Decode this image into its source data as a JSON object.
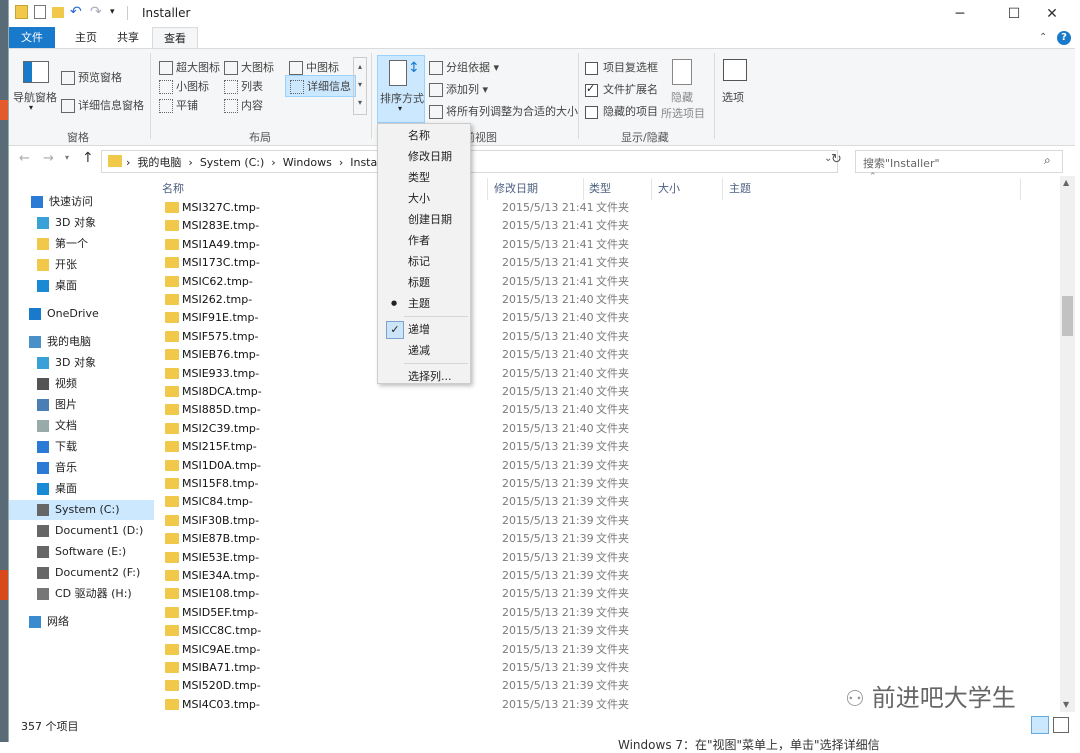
{
  "window": {
    "title": "Installer",
    "controls": {
      "minimize": "─",
      "maximize": "☐",
      "close": "✕"
    }
  },
  "tabs": [
    "文件",
    "主页",
    "共享",
    "查看"
  ],
  "ribbon": {
    "panes": {
      "nav_pane": "导航窗格",
      "preview_pane": "预览窗格",
      "details_pane": "详细信息窗格",
      "group": "窗格"
    },
    "layout": {
      "items": [
        "超大图标",
        "大图标",
        "中图标",
        "小图标",
        "列表",
        "详细信息",
        "平铺",
        "内容"
      ],
      "group": "布局"
    },
    "current_view": {
      "sort_by": "排序方式",
      "group_by": "分组依据",
      "add_columns": "添加列",
      "size_all_columns": "将所有列调整为合适的大小",
      "group": "当前视图",
      "group_visible": "前视图"
    },
    "show_hide": {
      "item_checkboxes": "项目复选框",
      "file_extensions": "文件扩展名",
      "hidden_items": "隐藏的项目",
      "hide_selected_1": "隐藏",
      "hide_selected_2": "所选项目",
      "group": "显示/隐藏",
      "item_checkboxes_checked": false,
      "file_extensions_checked": true,
      "hidden_items_checked": false
    },
    "options": "选项",
    "help": "?"
  },
  "address": {
    "crumbs": [
      "我的电脑",
      "System (C:)",
      "Windows",
      "Install"
    ],
    "search_placeholder": "搜索\"Installer\""
  },
  "nav": [
    {
      "label": "快速访问",
      "icon": "star-icon"
    },
    {
      "label": "3D 对象",
      "icon": "cube-icon"
    },
    {
      "label": "第一个",
      "icon": "folder-icon"
    },
    {
      "label": "开张",
      "icon": "folder-icon"
    },
    {
      "label": "桌面",
      "icon": "desktop-icon"
    },
    {
      "label": "OneDrive",
      "icon": "cloud-icon"
    },
    {
      "label": "我的电脑",
      "icon": "computer-icon"
    },
    {
      "label": "3D 对象",
      "icon": "cube-icon"
    },
    {
      "label": "视频",
      "icon": "video-icon"
    },
    {
      "label": "图片",
      "icon": "picture-icon"
    },
    {
      "label": "文档",
      "icon": "document-icon"
    },
    {
      "label": "下载",
      "icon": "download-icon"
    },
    {
      "label": "音乐",
      "icon": "music-icon"
    },
    {
      "label": "桌面",
      "icon": "desktop-icon"
    },
    {
      "label": "System (C:)",
      "icon": "drive-icon"
    },
    {
      "label": "Document1 (D:)",
      "icon": "drive-icon"
    },
    {
      "label": "Software (E:)",
      "icon": "drive-icon"
    },
    {
      "label": "Document2 (F:)",
      "icon": "drive-icon"
    },
    {
      "label": "CD 驱动器 (H:)",
      "icon": "cd-icon"
    },
    {
      "label": "网络",
      "icon": "network-icon"
    }
  ],
  "columns": [
    "名称",
    "修改日期",
    "类型",
    "大小",
    "主题"
  ],
  "files": [
    {
      "name": "MSI327C.tmp-",
      "date": "2015/5/13 21:41",
      "type": "文件夹"
    },
    {
      "name": "MSI283E.tmp-",
      "date": "2015/5/13 21:41",
      "type": "文件夹"
    },
    {
      "name": "MSI1A49.tmp-",
      "date": "2015/5/13 21:41",
      "type": "文件夹"
    },
    {
      "name": "MSI173C.tmp-",
      "date": "2015/5/13 21:41",
      "type": "文件夹"
    },
    {
      "name": "MSIC62.tmp-",
      "date": "2015/5/13 21:41",
      "type": "文件夹"
    },
    {
      "name": "MSI262.tmp-",
      "date": "2015/5/13 21:40",
      "type": "文件夹"
    },
    {
      "name": "MSIF91E.tmp-",
      "date": "2015/5/13 21:40",
      "type": "文件夹"
    },
    {
      "name": "MSIF575.tmp-",
      "date": "2015/5/13 21:40",
      "type": "文件夹"
    },
    {
      "name": "MSIEB76.tmp-",
      "date": "2015/5/13 21:40",
      "type": "文件夹"
    },
    {
      "name": "MSIE933.tmp-",
      "date": "2015/5/13 21:40",
      "type": "文件夹"
    },
    {
      "name": "MSI8DCA.tmp-",
      "date": "2015/5/13 21:40",
      "type": "文件夹"
    },
    {
      "name": "MSI885D.tmp-",
      "date": "2015/5/13 21:40",
      "type": "文件夹"
    },
    {
      "name": "MSI2C39.tmp-",
      "date": "2015/5/13 21:40",
      "type": "文件夹"
    },
    {
      "name": "MSI215F.tmp-",
      "date": "2015/5/13 21:39",
      "type": "文件夹"
    },
    {
      "name": "MSI1D0A.tmp-",
      "date": "2015/5/13 21:39",
      "type": "文件夹"
    },
    {
      "name": "MSI15F8.tmp-",
      "date": "2015/5/13 21:39",
      "type": "文件夹"
    },
    {
      "name": "MSIC84.tmp-",
      "date": "2015/5/13 21:39",
      "type": "文件夹"
    },
    {
      "name": "MSIF30B.tmp-",
      "date": "2015/5/13 21:39",
      "type": "文件夹"
    },
    {
      "name": "MSIE87B.tmp-",
      "date": "2015/5/13 21:39",
      "type": "文件夹"
    },
    {
      "name": "MSIE53E.tmp-",
      "date": "2015/5/13 21:39",
      "type": "文件夹"
    },
    {
      "name": "MSIE34A.tmp-",
      "date": "2015/5/13 21:39",
      "type": "文件夹"
    },
    {
      "name": "MSIE108.tmp-",
      "date": "2015/5/13 21:39",
      "type": "文件夹"
    },
    {
      "name": "MSID5EF.tmp-",
      "date": "2015/5/13 21:39",
      "type": "文件夹"
    },
    {
      "name": "MSICC8C.tmp-",
      "date": "2015/5/13 21:39",
      "type": "文件夹"
    },
    {
      "name": "MSIC9AE.tmp-",
      "date": "2015/5/13 21:39",
      "type": "文件夹"
    },
    {
      "name": "MSIBA71.tmp-",
      "date": "2015/5/13 21:39",
      "type": "文件夹"
    },
    {
      "name": "MSI520D.tmp-",
      "date": "2015/5/13 21:39",
      "type": "文件夹"
    },
    {
      "name": "MSI4C03.tmp-",
      "date": "2015/5/13 21:39",
      "type": "文件夹"
    }
  ],
  "sort_menu": {
    "items": [
      "名称",
      "修改日期",
      "类型",
      "大小",
      "创建日期",
      "作者",
      "标记",
      "标题",
      "主题"
    ],
    "order": [
      "递增",
      "递减"
    ],
    "choose": "选择列...",
    "selected_item": "主题",
    "selected_order": "递增"
  },
  "status": {
    "count": "357 个项目"
  },
  "watermark": "前进吧大学生",
  "bottom_text": "Windows 7：在\"视图\"菜单上，单击\"选择详细信",
  "colors": {
    "file_tab": "#1979ca",
    "folder": "#f0c94a",
    "selection": "#cce8ff"
  }
}
